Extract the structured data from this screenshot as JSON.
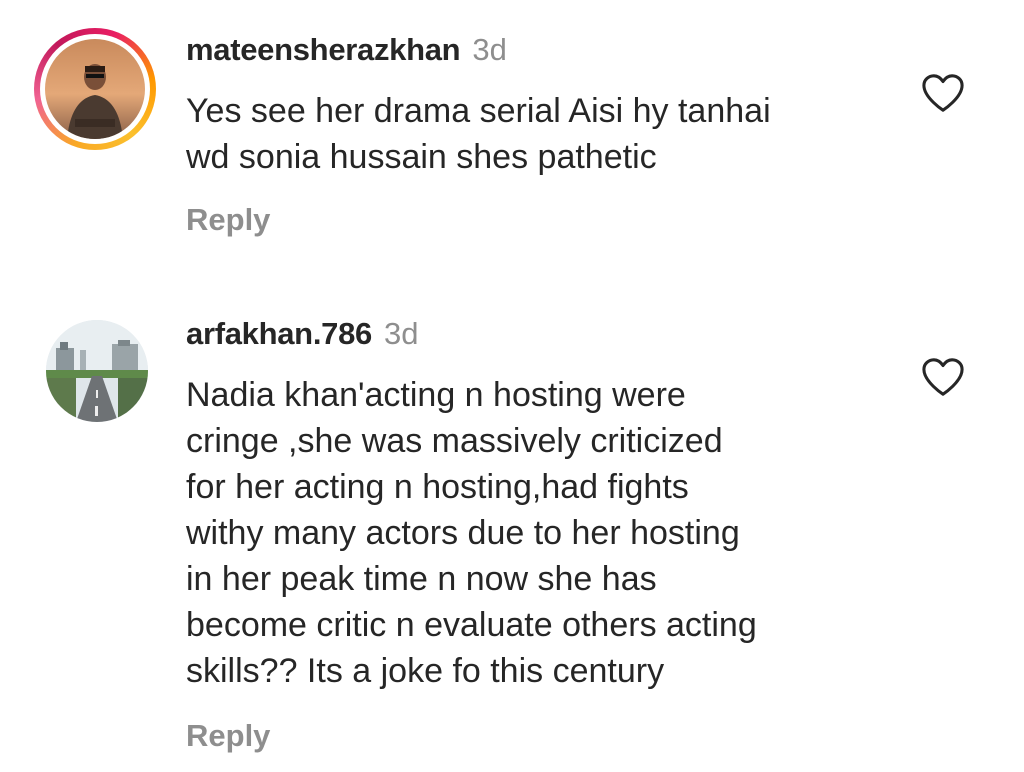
{
  "comments": [
    {
      "username": "mateensherazkhan",
      "time": "3d",
      "lines": [
        "Yes see her drama serial Aisi hy tanhai",
        "wd sonia hussain shes pathetic"
      ],
      "reply_label": "Reply",
      "has_story_ring": true,
      "like_icon": "heart-outline-icon"
    },
    {
      "username": "arfakhan.786",
      "time": "3d",
      "lines": [
        "Nadia khan'acting n hosting were",
        "cringe ,she was massively criticized",
        "for her acting n hosting,had fights",
        "withy many actors due to her hosting",
        "in her peak time n now she has",
        "become critic n evaluate others acting",
        "skills?? Its a joke fo this century"
      ],
      "reply_label": "Reply",
      "has_story_ring": false,
      "like_icon": "heart-outline-icon"
    }
  ],
  "colors": {
    "text": "#262626",
    "muted": "#8e8e8e",
    "background": "#ffffff"
  }
}
